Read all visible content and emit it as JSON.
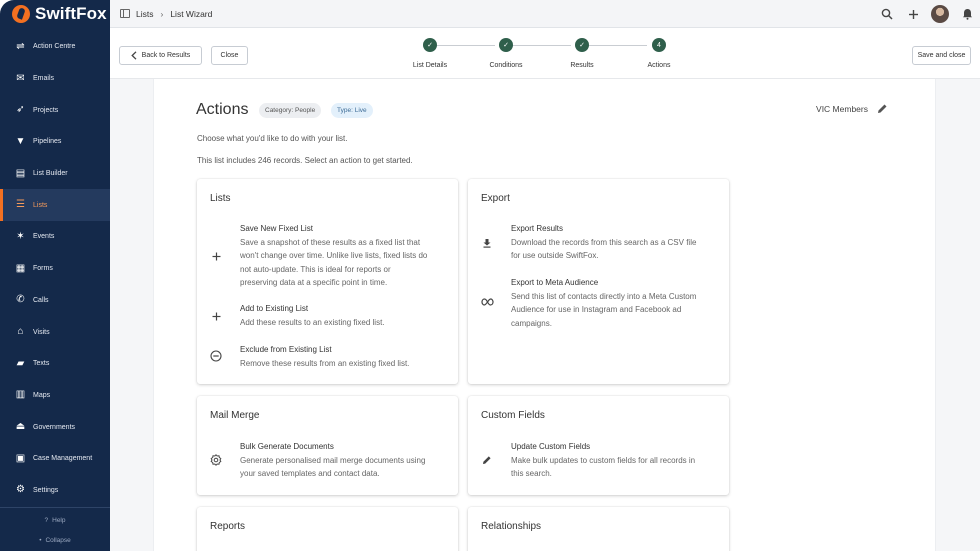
{
  "app": {
    "name": "SwiftFox"
  },
  "sidebar": {
    "items": [
      {
        "label": "Action Centre",
        "icon": "action-centre-icon",
        "glyph": "⇌"
      },
      {
        "label": "Emails",
        "icon": "email-icon",
        "glyph": "✉"
      },
      {
        "label": "Projects",
        "icon": "rocket-icon",
        "glyph": "➶"
      },
      {
        "label": "Pipelines",
        "icon": "funnel-icon",
        "glyph": "▼"
      },
      {
        "label": "List Builder",
        "icon": "list-builder-icon",
        "glyph": "▤"
      },
      {
        "label": "Lists",
        "icon": "list-icon",
        "glyph": "☰"
      },
      {
        "label": "Events",
        "icon": "party-icon",
        "glyph": "✶"
      },
      {
        "label": "Forms",
        "icon": "form-icon",
        "glyph": "▦"
      },
      {
        "label": "Calls",
        "icon": "phone-icon",
        "glyph": "✆"
      },
      {
        "label": "Visits",
        "icon": "house-icon",
        "glyph": "⌂"
      },
      {
        "label": "Texts",
        "icon": "chat-icon",
        "glyph": "▰"
      },
      {
        "label": "Maps",
        "icon": "map-icon",
        "glyph": "▥"
      },
      {
        "label": "Governments",
        "icon": "government-icon",
        "glyph": "⏏"
      },
      {
        "label": "Case Management",
        "icon": "case-icon",
        "glyph": "▣"
      },
      {
        "label": "Settings",
        "icon": "gear-icon",
        "glyph": "⚙"
      }
    ],
    "active": "Lists",
    "help": "Help",
    "collapse": "Collapse"
  },
  "topbar": {
    "breadcrumb": [
      "Lists",
      "List Wizard"
    ],
    "icons": [
      "search-icon",
      "plus-icon",
      "avatar",
      "bell-icon"
    ]
  },
  "wizard": {
    "back_label": "Back to Results",
    "close_label": "Close",
    "save_label": "Save and close",
    "steps": [
      {
        "label": "List Details",
        "state": "done"
      },
      {
        "label": "Conditions",
        "state": "done"
      },
      {
        "label": "Results",
        "state": "done"
      },
      {
        "label": "Actions",
        "state": "current",
        "number": "4"
      }
    ]
  },
  "page": {
    "title": "Actions",
    "chip_category": "Category: People",
    "chip_type": "Type: Live",
    "list_name": "VIC Members",
    "subtitle": "Choose what you'd like to do with your list.",
    "record_note": "This list includes 246 records. Select an action to get started."
  },
  "cards": {
    "lists": {
      "title": "Lists",
      "actions": [
        {
          "title": "Save New Fixed List",
          "desc": [
            "Save a snapshot of these results as a fixed list that",
            "won't change over time. Unlike live lists, fixed lists do",
            "not auto-update. This is ideal for reports or",
            "preserving data at a specific point in time."
          ],
          "icon": "plus-icon"
        },
        {
          "title": "Add to Existing List",
          "desc": [
            "Add these results to an existing fixed list."
          ],
          "icon": "plus-icon"
        },
        {
          "title": "Exclude from Existing List",
          "desc": [
            "Remove these results from an existing fixed list."
          ],
          "icon": "minus-circle-icon"
        }
      ]
    },
    "export": {
      "title": "Export",
      "actions": [
        {
          "title": "Export Results",
          "desc": [
            "Download the records from this search as a CSV file",
            "for use outside SwiftFox."
          ],
          "icon": "download-icon"
        },
        {
          "title": "Export to Meta Audience",
          "desc": [
            "Send this list of contacts directly into a Meta Custom",
            "Audience for use in Instagram and Facebook ad",
            "campaigns."
          ],
          "icon": "meta-icon"
        }
      ]
    },
    "mail_merge": {
      "title": "Mail Merge",
      "actions": [
        {
          "title": "Bulk Generate Documents",
          "desc": [
            "Generate personalised mail merge documents using",
            "your saved templates and contact data."
          ],
          "icon": "badge-icon"
        }
      ]
    },
    "custom_fields": {
      "title": "Custom Fields",
      "actions": [
        {
          "title": "Update Custom Fields",
          "desc": [
            "Make bulk updates to custom fields for all records in",
            "this search."
          ],
          "icon": "pencil-icon"
        }
      ]
    },
    "reports": {
      "title": "Reports"
    },
    "relationships": {
      "title": "Relationships"
    }
  },
  "colors": {
    "sidebar_bg": "#14294a",
    "accent": "#f37021",
    "step_done": "#2f5f4b",
    "chip_live_bg": "#e3f0fb"
  }
}
